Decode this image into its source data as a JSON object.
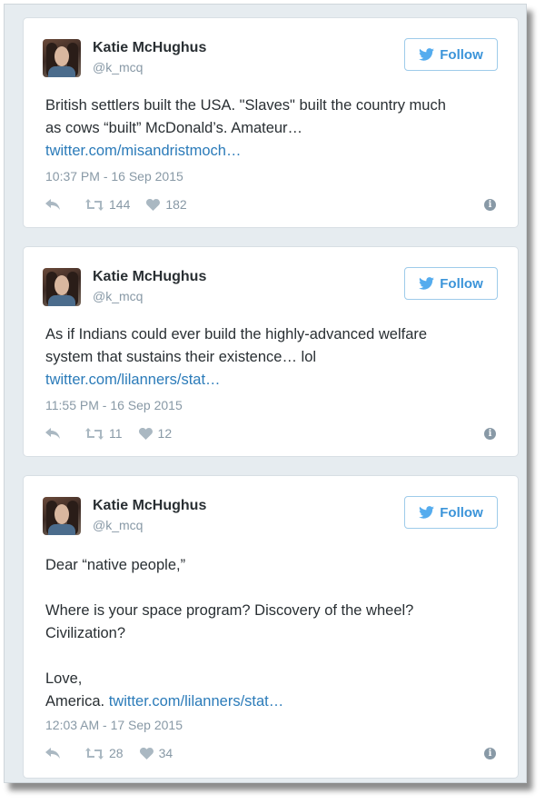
{
  "tweets": [
    {
      "name": "Katie McHughus",
      "handle": "@k_mcq",
      "follow_label": "Follow",
      "lines": [
        {
          "text": "British settlers built the USA. \"Slaves\" built the country much",
          "link": ""
        },
        {
          "text": "as cows “built” McDonald’s. Amateur…",
          "link": ""
        },
        {
          "text": "",
          "link": "twitter.com/misandristmoch…"
        }
      ],
      "timestamp": "10:37 PM - 16 Sep 2015",
      "retweets": "144",
      "likes": "182"
    },
    {
      "name": "Katie McHughus",
      "handle": "@k_mcq",
      "follow_label": "Follow",
      "lines": [
        {
          "text": "As if Indians could ever build the highly-advanced welfare",
          "link": ""
        },
        {
          "text": "system that sustains their existence… lol",
          "link": ""
        },
        {
          "text": "",
          "link": "twitter.com/lilanners/stat…"
        }
      ],
      "timestamp": "11:55 PM - 16 Sep 2015",
      "retweets": "11",
      "likes": "12"
    },
    {
      "name": "Katie McHughus",
      "handle": "@k_mcq",
      "follow_label": "Follow",
      "lines": [
        {
          "text": "Dear “native people,”",
          "link": ""
        },
        {
          "text": "",
          "link": ""
        },
        {
          "text": "Where is your space program? Discovery of the wheel?",
          "link": ""
        },
        {
          "text": "Civilization?",
          "link": ""
        },
        {
          "text": "",
          "link": ""
        },
        {
          "text": "Love,",
          "link": ""
        },
        {
          "text": "America. ",
          "link": "twitter.com/lilanners/stat…"
        }
      ],
      "timestamp": "12:03 AM - 17 Sep 2015",
      "retweets": "28",
      "likes": "34"
    }
  ],
  "icons": {
    "follow": "twitter-bird-icon",
    "reply": "reply-icon",
    "retweet": "retweet-icon",
    "like": "heart-icon",
    "more": "info-icon"
  },
  "colors": {
    "link": "#2b7bb9",
    "follow_text": "#3b94d9",
    "muted": "#8899a6",
    "background": "#e6ecf0"
  }
}
